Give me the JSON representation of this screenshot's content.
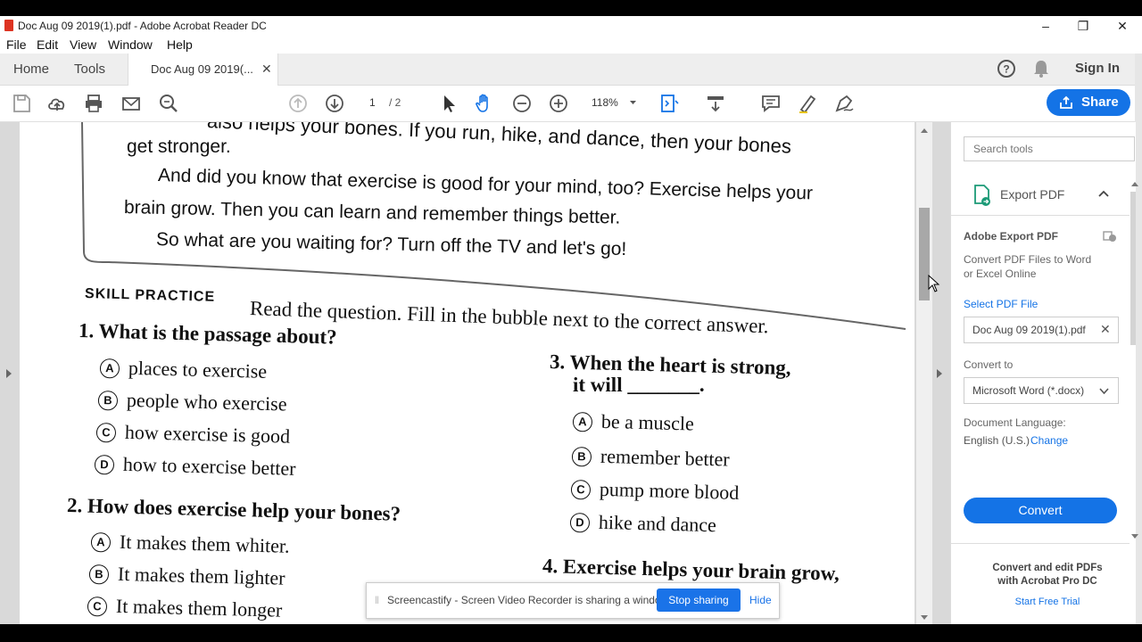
{
  "window": {
    "title": "Doc Aug 09 2019(1).pdf - Adobe Acrobat Reader DC"
  },
  "menu": [
    "File",
    "Edit",
    "View",
    "Window",
    "Help"
  ],
  "tabs": {
    "home": "Home",
    "tools": "Tools",
    "doc": "Doc Aug 09 2019(..."
  },
  "header": {
    "sign_in": "Sign In",
    "share": "Share"
  },
  "toolbar": {
    "page_current": "1",
    "page_total": "/ 2",
    "zoom": "118%"
  },
  "document": {
    "lines": [
      "get stronger.",
      "And did you know that exercise is good for your mind, too? Exercise helps your",
      "brain grow. Then you can learn and remember things better.",
      "So what are you waiting for? Turn off the TV and let's go!"
    ],
    "cut_top_line": "also helps your bones. If you run, hike, and dance, then your bones",
    "skill_label": "SKILL PRACTICE",
    "instruction": "Read the question. Fill in the bubble next to the correct answer.",
    "q1": {
      "text": "1. What is the passage about?",
      "options": [
        "places to exercise",
        "people who exercise",
        "how exercise is good",
        "how to exercise better"
      ]
    },
    "q2": {
      "text": "2. How does exercise help your bones?",
      "options": [
        "It makes them whiter.",
        "It makes them lighter",
        "It makes them longer"
      ]
    },
    "q3": {
      "line1": "3. When the heart is strong,",
      "line2": "it will _______.",
      "options": [
        "be a muscle",
        "remember better",
        "pump more blood",
        "hike and dance"
      ]
    },
    "q4": {
      "text": "4. Exercise helps your brain grow,"
    },
    "bubbles": [
      "A",
      "B",
      "C",
      "D"
    ]
  },
  "right_panel": {
    "search_placeholder": "Search tools",
    "export_title": "Export PDF",
    "adobe_export": "Adobe Export PDF",
    "convert_desc_1": "Convert PDF Files to Word",
    "convert_desc_2": "or Excel Online",
    "select_file": "Select PDF File",
    "file_name": "Doc Aug 09 2019(1).pdf",
    "convert_to": "Convert to",
    "format": "Microsoft Word (*.docx)",
    "doc_language": "Document Language:",
    "language": "English (U.S.)",
    "change": "Change",
    "convert_button": "Convert",
    "promo_1": "Convert and edit PDFs",
    "promo_2": "with Acrobat Pro DC",
    "trial": "Start Free Trial"
  },
  "screencastify": {
    "message": "Screencastify - Screen Video Recorder is sharing a window.",
    "stop": "Stop sharing",
    "hide": "Hide"
  },
  "colors": {
    "accent": "#1473e6",
    "tab_bg": "#eeeeee",
    "doc_bg": "#d9d9d9"
  }
}
